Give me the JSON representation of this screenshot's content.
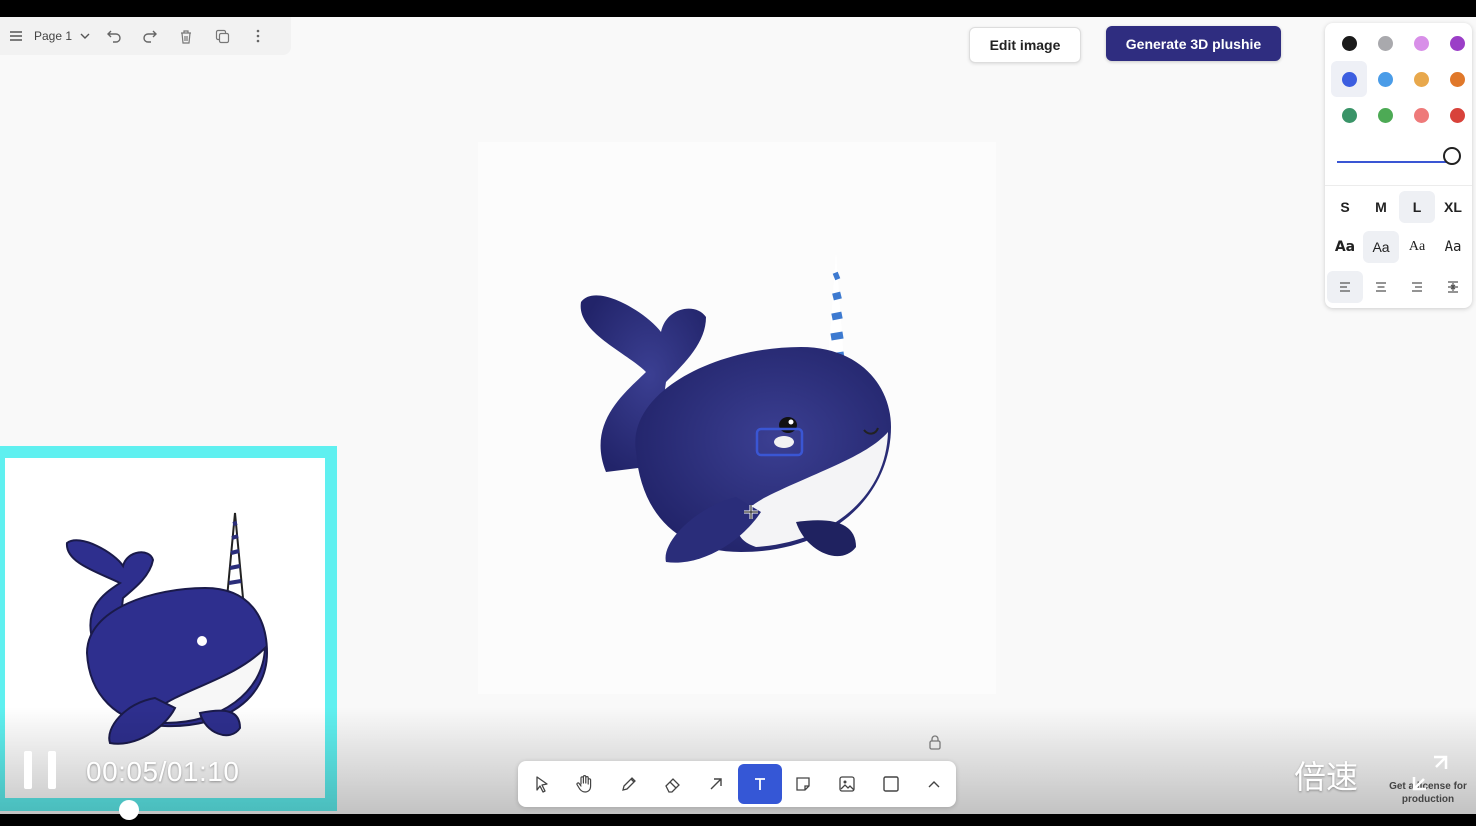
{
  "page_bar": {
    "page_label": "Page 1"
  },
  "actions": {
    "edit_label": "Edit image",
    "generate_label": "Generate 3D plushie"
  },
  "style_panel": {
    "colors": [
      "#1a1a1a",
      "#a9a9ad",
      "#d88fe8",
      "#9b3ec7",
      "#3c5ee0",
      "#4a9ce8",
      "#e8a84c",
      "#e0782a",
      "#3a9468",
      "#4daa55",
      "#ee7a7a",
      "#d8423a"
    ],
    "selected_color": "#3c5ee0",
    "opacity_percent": 100,
    "sizes": [
      "S",
      "M",
      "L",
      "XL"
    ],
    "selected_size": "L",
    "fonts": [
      "Aa",
      "Aa",
      "Aa",
      "Aa"
    ],
    "selected_font_index": 1,
    "alignments": [
      "align-left",
      "align-center",
      "align-right",
      "align-vertical"
    ],
    "selected_alignment_index": 0
  },
  "video": {
    "time": "00:05/01:10",
    "speed_label": "倍速",
    "promo_text": "Get a license for production"
  },
  "tools": [
    "select",
    "hand",
    "draw",
    "eraser",
    "arrow",
    "text",
    "note",
    "image",
    "rectangle",
    "more"
  ],
  "active_tool": "text"
}
